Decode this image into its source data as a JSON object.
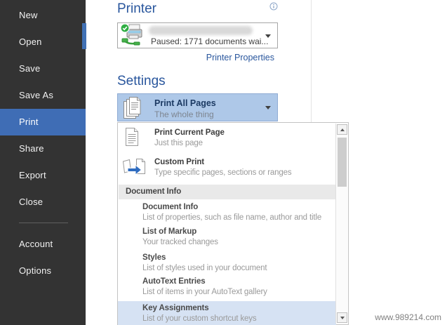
{
  "sidebar": {
    "items": [
      {
        "label": "New"
      },
      {
        "label": "Open"
      },
      {
        "label": "Save"
      },
      {
        "label": "Save As"
      },
      {
        "label": "Print",
        "active": true
      },
      {
        "label": "Share"
      },
      {
        "label": "Export"
      },
      {
        "label": "Close"
      },
      {
        "label": "Account"
      },
      {
        "label": "Options"
      }
    ],
    "active_item": "Print"
  },
  "printer_section": {
    "heading": "Printer",
    "selected_printer": {
      "name_redacted": true,
      "status": "Paused: 1771 documents wai..."
    },
    "properties_link": "Printer Properties"
  },
  "settings_section": {
    "heading": "Settings",
    "selected_option": {
      "title": "Print All Pages",
      "subtitle": "The whole thing"
    }
  },
  "print_options_dropdown": {
    "icon_items": [
      {
        "title": "Print Current Page",
        "subtitle": "Just this page",
        "icon": "print-current-page-icon"
      },
      {
        "title": "Custom Print",
        "subtitle": "Type specific pages, sections or ranges",
        "icon": "custom-print-icon"
      }
    ],
    "section_header": "Document Info",
    "document_items": [
      {
        "title": "Document Info",
        "subtitle": "List of properties, such as file name, author and title"
      },
      {
        "title": "List of Markup",
        "subtitle": "Your tracked changes"
      },
      {
        "title": "Styles",
        "subtitle": "List of styles used in your document"
      },
      {
        "title": "AutoText Entries",
        "subtitle": "List of items in your AutoText gallery"
      },
      {
        "title": "Key Assignments",
        "subtitle": "List of your custom shortcut keys",
        "highlighted": true
      }
    ]
  },
  "watermark": "www.989214.com",
  "colors": {
    "sidebar_bg": "#333333",
    "accent_blue": "#3f6db5",
    "heading_blue": "#29569d",
    "selected_option_bg": "#aec8e8",
    "highlight_row_bg": "#d6e2f3",
    "status_green": "#2fae43"
  }
}
